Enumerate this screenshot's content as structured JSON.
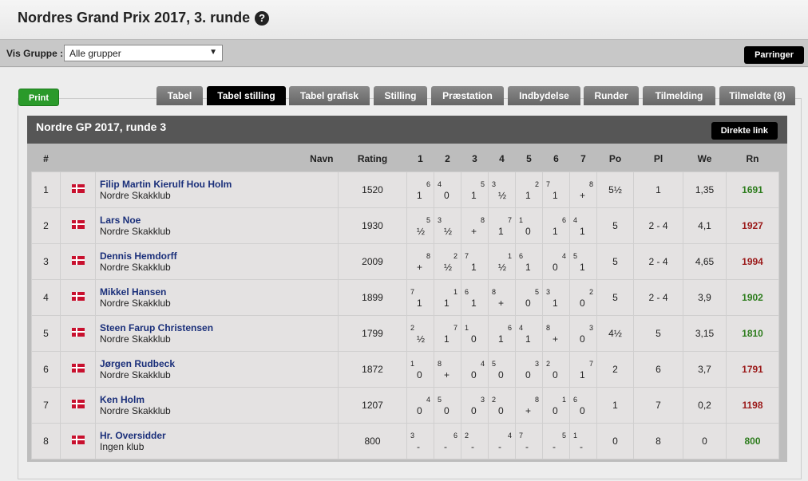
{
  "page": {
    "title": "Nordres Grand Prix 2017, 3. runde",
    "help_icon": "?"
  },
  "group_bar": {
    "label": "Vis Gruppe :",
    "selected": "Alle grupper",
    "pairing_button": "Parringer"
  },
  "print_button": "Print",
  "tabs": [
    {
      "label": "Tabel",
      "active": false
    },
    {
      "label": "Tabel stilling",
      "active": true
    },
    {
      "label": "Tabel grafisk",
      "active": false
    },
    {
      "label": "Stilling",
      "active": false
    },
    {
      "label": "Præstation",
      "active": false
    },
    {
      "label": "Indbydelse",
      "active": false
    },
    {
      "label": "Runder",
      "active": false
    },
    {
      "label": "Tilmelding",
      "active": false
    },
    {
      "label": "Tilmeldte (8)",
      "active": false
    }
  ],
  "box": {
    "title": "Nordre GP 2017, runde 3",
    "direct_link": "Direkte link"
  },
  "columns": [
    "#",
    "",
    "Navn",
    "Rating",
    "1",
    "2",
    "3",
    "4",
    "5",
    "6",
    "7",
    "Po",
    "Pl",
    "We",
    "Rn"
  ],
  "colors": {
    "rn_positive": "#2e7d1e",
    "rn_negative": "#9b1a1a",
    "name_link": "#1a2f7a",
    "flag": "#c8102e"
  },
  "rows": [
    {
      "num": "1",
      "name": "Filip Martin Kierulf Hou Holm",
      "club": "Nordre Skakklub",
      "rating": "1520",
      "rounds": [
        {
          "opp": "6",
          "side": "r",
          "res": "1"
        },
        {
          "opp": "4",
          "side": "l",
          "res": "0"
        },
        {
          "opp": "5",
          "side": "r",
          "res": "1"
        },
        {
          "opp": "3",
          "side": "l",
          "res": "½"
        },
        {
          "opp": "2",
          "side": "r",
          "res": "1"
        },
        {
          "opp": "7",
          "side": "l",
          "res": "1"
        },
        {
          "opp": "8",
          "side": "r",
          "res": "+"
        }
      ],
      "po": "5½",
      "pl": "1",
      "we": "1,35",
      "rn": "1691",
      "rn_up": true
    },
    {
      "num": "2",
      "name": "Lars Noe",
      "club": "Nordre Skakklub",
      "rating": "1930",
      "rounds": [
        {
          "opp": "5",
          "side": "r",
          "res": "½"
        },
        {
          "opp": "3",
          "side": "l",
          "res": "½"
        },
        {
          "opp": "8",
          "side": "r",
          "res": "+"
        },
        {
          "opp": "7",
          "side": "r",
          "res": "1"
        },
        {
          "opp": "1",
          "side": "l",
          "res": "0"
        },
        {
          "opp": "6",
          "side": "r",
          "res": "1"
        },
        {
          "opp": "4",
          "side": "l",
          "res": "1"
        }
      ],
      "po": "5",
      "pl": "2 - 4",
      "we": "4,1",
      "rn": "1927",
      "rn_up": false
    },
    {
      "num": "3",
      "name": "Dennis Hemdorff",
      "club": "Nordre Skakklub",
      "rating": "2009",
      "rounds": [
        {
          "opp": "8",
          "side": "r",
          "res": "+"
        },
        {
          "opp": "2",
          "side": "r",
          "res": "½"
        },
        {
          "opp": "7",
          "side": "l",
          "res": "1"
        },
        {
          "opp": "1",
          "side": "r",
          "res": "½"
        },
        {
          "opp": "6",
          "side": "l",
          "res": "1"
        },
        {
          "opp": "4",
          "side": "r",
          "res": "0"
        },
        {
          "opp": "5",
          "side": "l",
          "res": "1"
        }
      ],
      "po": "5",
      "pl": "2 - 4",
      "we": "4,65",
      "rn": "1994",
      "rn_up": false
    },
    {
      "num": "4",
      "name": "Mikkel Hansen",
      "club": "Nordre Skakklub",
      "rating": "1899",
      "rounds": [
        {
          "opp": "7",
          "side": "l",
          "res": "1"
        },
        {
          "opp": "1",
          "side": "r",
          "res": "1"
        },
        {
          "opp": "6",
          "side": "l",
          "res": "1"
        },
        {
          "opp": "8",
          "side": "l",
          "res": "+"
        },
        {
          "opp": "5",
          "side": "r",
          "res": "0"
        },
        {
          "opp": "3",
          "side": "l",
          "res": "1"
        },
        {
          "opp": "2",
          "side": "r",
          "res": "0"
        }
      ],
      "po": "5",
      "pl": "2 - 4",
      "we": "3,9",
      "rn": "1902",
      "rn_up": true
    },
    {
      "num": "5",
      "name": "Steen Farup Christensen",
      "club": "Nordre Skakklub",
      "rating": "1799",
      "rounds": [
        {
          "opp": "2",
          "side": "l",
          "res": "½"
        },
        {
          "opp": "7",
          "side": "r",
          "res": "1"
        },
        {
          "opp": "1",
          "side": "l",
          "res": "0"
        },
        {
          "opp": "6",
          "side": "r",
          "res": "1"
        },
        {
          "opp": "4",
          "side": "l",
          "res": "1"
        },
        {
          "opp": "8",
          "side": "l",
          "res": "+"
        },
        {
          "opp": "3",
          "side": "r",
          "res": "0"
        }
      ],
      "po": "4½",
      "pl": "5",
      "we": "3,15",
      "rn": "1810",
      "rn_up": true
    },
    {
      "num": "6",
      "name": "Jørgen Rudbeck",
      "club": "Nordre Skakklub",
      "rating": "1872",
      "rounds": [
        {
          "opp": "1",
          "side": "l",
          "res": "0"
        },
        {
          "opp": "8",
          "side": "l",
          "res": "+"
        },
        {
          "opp": "4",
          "side": "r",
          "res": "0"
        },
        {
          "opp": "5",
          "side": "l",
          "res": "0"
        },
        {
          "opp": "3",
          "side": "r",
          "res": "0"
        },
        {
          "opp": "2",
          "side": "l",
          "res": "0"
        },
        {
          "opp": "7",
          "side": "r",
          "res": "1"
        }
      ],
      "po": "2",
      "pl": "6",
      "we": "3,7",
      "rn": "1791",
      "rn_up": false
    },
    {
      "num": "7",
      "name": "Ken Holm",
      "club": "Nordre Skakklub",
      "rating": "1207",
      "rounds": [
        {
          "opp": "4",
          "side": "r",
          "res": "0"
        },
        {
          "opp": "5",
          "side": "l",
          "res": "0"
        },
        {
          "opp": "3",
          "side": "r",
          "res": "0"
        },
        {
          "opp": "2",
          "side": "l",
          "res": "0"
        },
        {
          "opp": "8",
          "side": "r",
          "res": "+"
        },
        {
          "opp": "1",
          "side": "r",
          "res": "0"
        },
        {
          "opp": "6",
          "side": "l",
          "res": "0"
        }
      ],
      "po": "1",
      "pl": "7",
      "we": "0,2",
      "rn": "1198",
      "rn_up": false
    },
    {
      "num": "8",
      "name": "Hr. Oversidder",
      "club": "Ingen klub",
      "rating": "800",
      "rounds": [
        {
          "opp": "3",
          "side": "l",
          "res": "-"
        },
        {
          "opp": "6",
          "side": "r",
          "res": "-"
        },
        {
          "opp": "2",
          "side": "l",
          "res": "-"
        },
        {
          "opp": "4",
          "side": "r",
          "res": "-"
        },
        {
          "opp": "7",
          "side": "l",
          "res": "-"
        },
        {
          "opp": "5",
          "side": "r",
          "res": "-"
        },
        {
          "opp": "1",
          "side": "l",
          "res": "-"
        }
      ],
      "po": "0",
      "pl": "8",
      "we": "0",
      "rn": "800",
      "rn_up": true
    }
  ]
}
